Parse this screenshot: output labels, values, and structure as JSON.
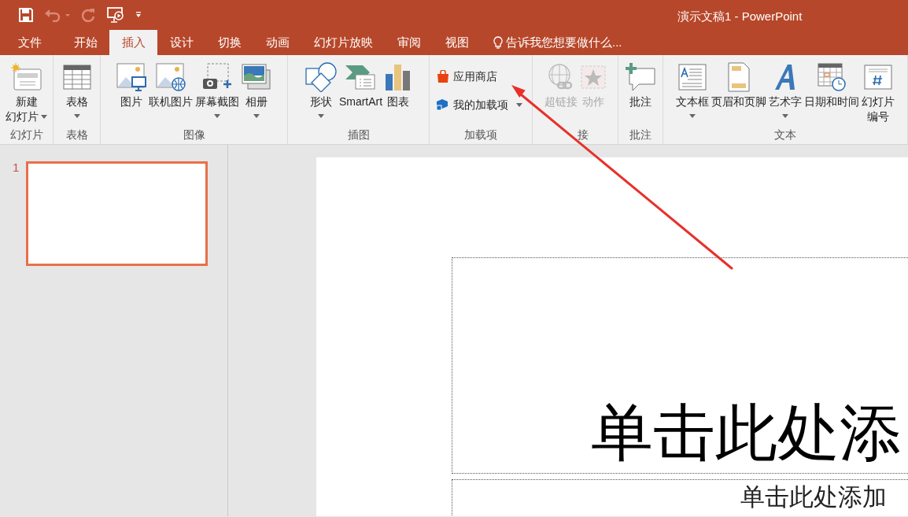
{
  "window": {
    "title": "演示文稿1 - PowerPoint"
  },
  "quick_access": {
    "undo_disabled": true,
    "redo_disabled": true
  },
  "tabs": [
    {
      "label": "文件",
      "selected": false
    },
    {
      "label": "开始",
      "selected": false
    },
    {
      "label": "插入",
      "selected": true
    },
    {
      "label": "设计",
      "selected": false
    },
    {
      "label": "切换",
      "selected": false
    },
    {
      "label": "动画",
      "selected": false
    },
    {
      "label": "幻灯片放映",
      "selected": false
    },
    {
      "label": "审阅",
      "selected": false
    },
    {
      "label": "视图",
      "selected": false
    }
  ],
  "tell_me": {
    "placeholder": "告诉我您想要做什么..."
  },
  "ribbon": {
    "groups": [
      {
        "label": "幻灯片",
        "buttons": [
          {
            "kind": "large",
            "lines": [
              "新建",
              "幻灯片"
            ],
            "dropdown": true,
            "disabled": false
          }
        ]
      },
      {
        "label": "表格",
        "buttons": [
          {
            "kind": "large",
            "lines": [
              "表格"
            ],
            "dropdown": true,
            "disabled": false
          }
        ]
      },
      {
        "label": "图像",
        "buttons": [
          {
            "kind": "large",
            "lines": [
              "图片"
            ],
            "dropdown": false,
            "disabled": false
          },
          {
            "kind": "large",
            "lines": [
              "联机图片"
            ],
            "dropdown": false,
            "disabled": false
          },
          {
            "kind": "large",
            "lines": [
              "屏幕截图"
            ],
            "dropdown": true,
            "disabled": false
          },
          {
            "kind": "large",
            "lines": [
              "相册"
            ],
            "dropdown": true,
            "disabled": false
          }
        ]
      },
      {
        "label": "插图",
        "buttons": [
          {
            "kind": "large",
            "lines": [
              "形状"
            ],
            "dropdown": true,
            "disabled": false
          },
          {
            "kind": "large",
            "lines": [
              "SmartArt"
            ],
            "dropdown": false,
            "disabled": false
          },
          {
            "kind": "large",
            "lines": [
              "图表"
            ],
            "dropdown": false,
            "disabled": false
          }
        ]
      },
      {
        "label": "加载项",
        "buttons": [
          {
            "kind": "small",
            "lines": [
              "应用商店"
            ],
            "dropdown": false,
            "disabled": false
          },
          {
            "kind": "small",
            "lines": [
              "我的加载项"
            ],
            "dropdown": true,
            "disabled": false
          }
        ]
      },
      {
        "label": "接",
        "buttons": [
          {
            "kind": "large",
            "lines": [
              "超链接"
            ],
            "dropdown": false,
            "disabled": true
          },
          {
            "kind": "large",
            "lines": [
              "动作"
            ],
            "dropdown": false,
            "disabled": true
          }
        ]
      },
      {
        "label": "批注",
        "buttons": [
          {
            "kind": "large",
            "lines": [
              "批注"
            ],
            "dropdown": false,
            "disabled": false
          }
        ]
      },
      {
        "label": "文本",
        "buttons": [
          {
            "kind": "large",
            "lines": [
              "文本框"
            ],
            "dropdown": true,
            "disabled": false
          },
          {
            "kind": "large",
            "lines": [
              "页眉和页脚"
            ],
            "dropdown": false,
            "disabled": false
          },
          {
            "kind": "large",
            "lines": [
              "艺术字"
            ],
            "dropdown": true,
            "disabled": false
          },
          {
            "kind": "large",
            "lines": [
              "日期和时间"
            ],
            "dropdown": false,
            "disabled": false
          },
          {
            "kind": "large",
            "lines": [
              "幻灯片",
              "编号"
            ],
            "dropdown": false,
            "disabled": false
          }
        ]
      }
    ]
  },
  "thumbnails": [
    {
      "number": "1",
      "selected": true
    }
  ],
  "slide": {
    "title_placeholder": "单击此处添",
    "subtitle_placeholder": "单击此处添加"
  }
}
